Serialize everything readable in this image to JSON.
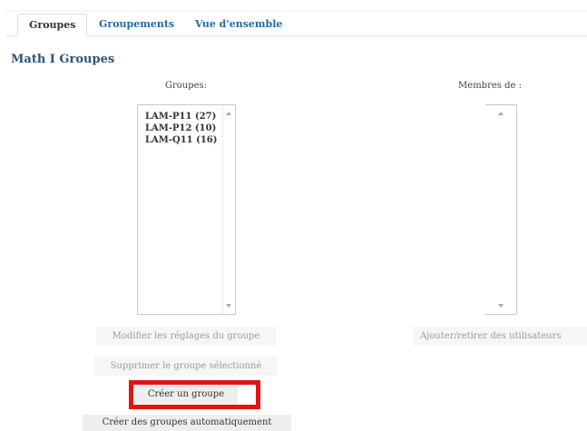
{
  "tabs": [
    {
      "label": "Groupes",
      "active": true
    },
    {
      "label": "Groupements",
      "active": false
    },
    {
      "label": "Vue d'ensemble",
      "active": false
    }
  ],
  "page_title": "Math I Groupes",
  "groups_panel": {
    "label": "Groupes:",
    "options": [
      "LAM-P11 (27)",
      "LAM-P12 (10)",
      "LAM-Q11 (16)"
    ]
  },
  "members_panel": {
    "label": "Membres de :",
    "options": []
  },
  "buttons": {
    "edit_group": "Modifier les réglages du groupe",
    "delete_group": "Supprimer le groupe sélectionné",
    "create_group": "Créer un groupe",
    "auto_create": "Créer des groupes automatiquement",
    "add_remove_users": "Ajouter/retirer des utilisateurs"
  },
  "colors": {
    "link": "#1b6ea8",
    "title": "#2c5477",
    "highlight": "#e5130f"
  }
}
